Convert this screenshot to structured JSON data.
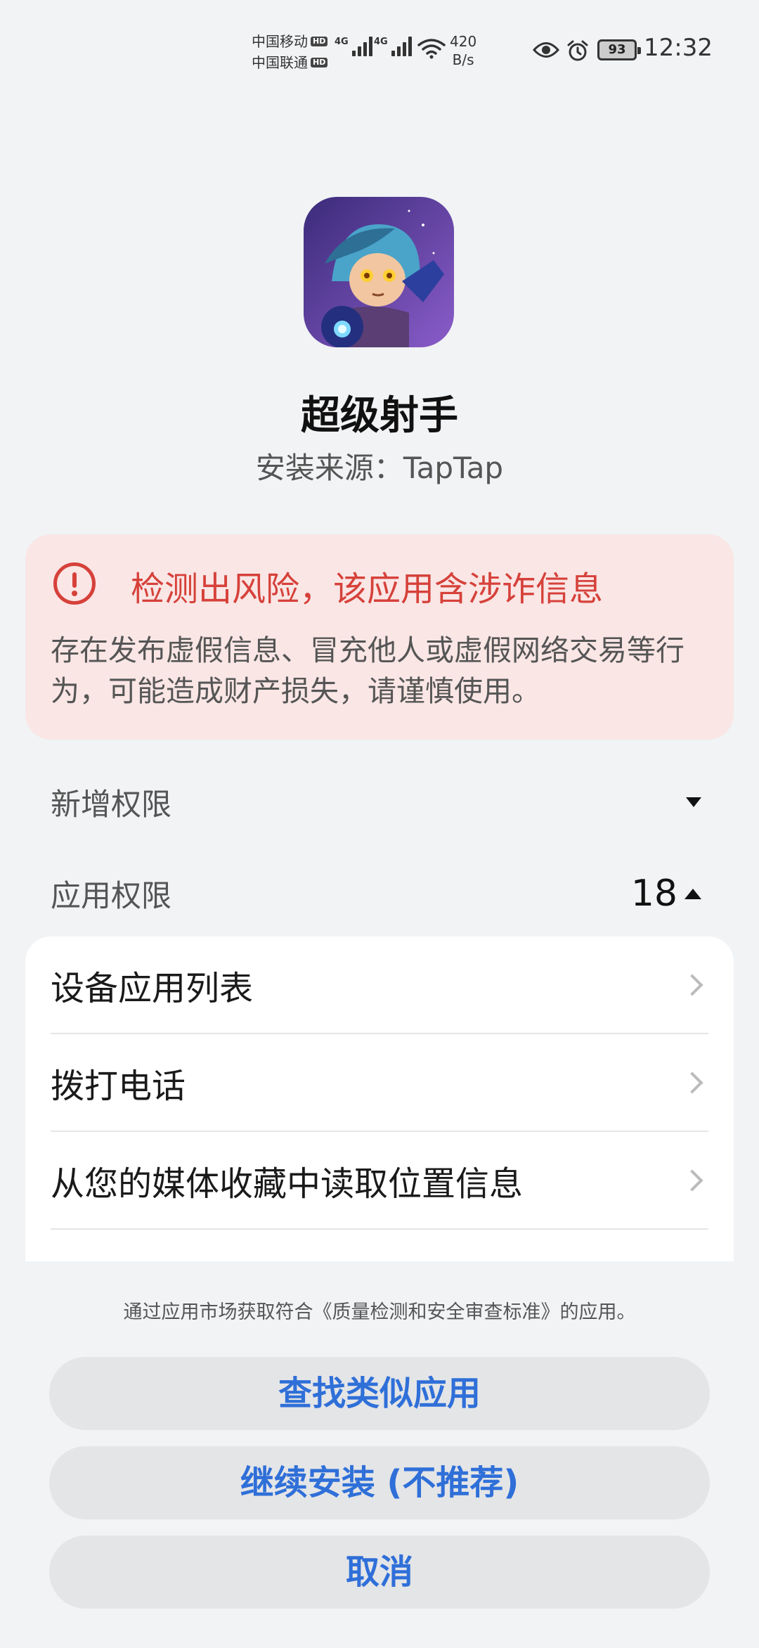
{
  "status_bar": {
    "carrier1": "中国移动",
    "carrier2": "中国联通",
    "hd_badge": "HD",
    "network1": "4G",
    "network2": "4G",
    "net_speed_value": "420",
    "net_speed_unit": "B/s",
    "battery": "93",
    "time": "12:32"
  },
  "app": {
    "icon": "game-character-icon",
    "name": "超级射手",
    "source": "安装来源：TapTap"
  },
  "risk": {
    "icon": "warning-circle-icon",
    "color": "#d6413a",
    "title": "检测出风险，该应用含涉诈信息",
    "description": "存在发布虚假信息、冒充他人或虚假网络交易等行为，可能造成财产损失，请谨慎使用。"
  },
  "permissions": {
    "new_label": "新增权限",
    "app_label": "应用权限",
    "app_count": "18",
    "items": [
      {
        "label": "设备应用列表"
      },
      {
        "label": "拨打电话"
      },
      {
        "label": "从您的媒体收藏中读取位置信息"
      }
    ]
  },
  "footer": {
    "note": "通过应用市场获取符合《质量检测和安全审查标准》的应用。",
    "accent": "#2f6fd8",
    "buttons": {
      "find_similar": "查找类似应用",
      "continue_install": "继续安装 (不推荐)",
      "cancel": "取消"
    }
  }
}
